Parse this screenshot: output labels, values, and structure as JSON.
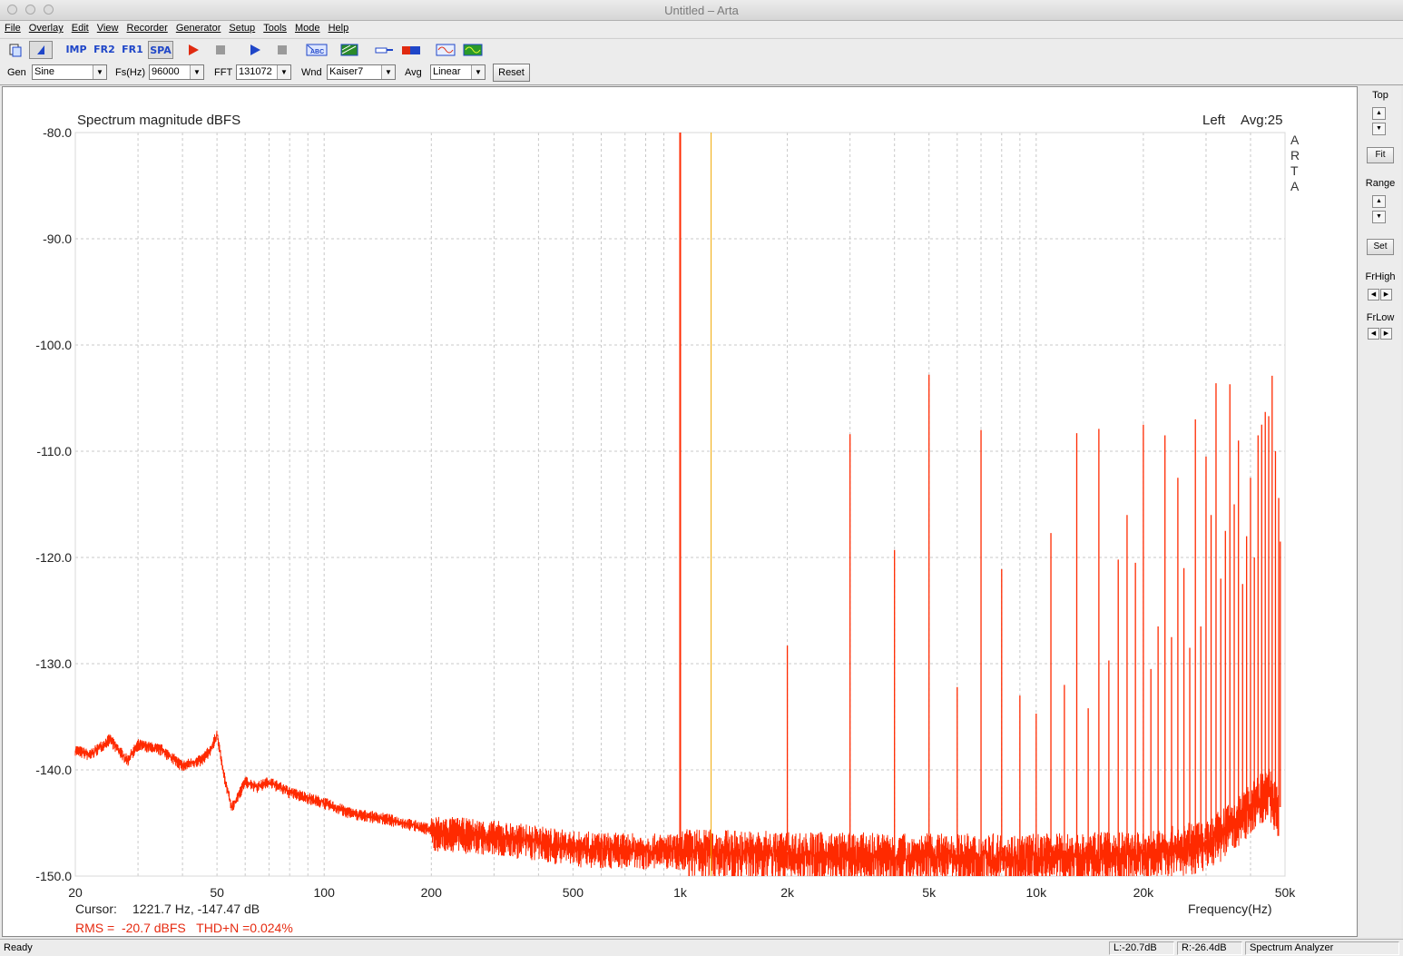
{
  "window": {
    "title": "Untitled – Arta"
  },
  "menu": [
    "File",
    "Overlay",
    "Edit",
    "View",
    "Recorder",
    "Generator",
    "Setup",
    "Tools",
    "Mode",
    "Help"
  ],
  "toolbar": {
    "imp_label": "IMP",
    "fr2_label": "FR2",
    "fr1_label": "FR1",
    "spa_label": "SPA",
    "icons": [
      "new-file-icon",
      "analyzer-cursor-icon",
      "imp-icon",
      "fr2-icon",
      "fr1-icon",
      "spa-icon",
      "record-icon",
      "stop-icon",
      "play-icon",
      "stop2-icon",
      "abc-icon",
      "spectrogram-icon",
      "probe-icon",
      "level-meter-icon",
      "generator-icon",
      "scope-icon"
    ]
  },
  "settings": {
    "gen_label": "Gen",
    "gen_value": "Sine",
    "fs_label": "Fs(Hz)",
    "fs_value": "96000",
    "fft_label": "FFT",
    "fft_value": "131072",
    "wnd_label": "Wnd",
    "wnd_value": "Kaiser7",
    "avg_label": "Avg",
    "avg_value": "Linear",
    "reset_label": "Reset"
  },
  "plot": {
    "channel": "Left",
    "avg": "Avg:25",
    "brand_letters": [
      "A",
      "R",
      "T",
      "A"
    ],
    "cursor_label": "Cursor:",
    "cursor_value": "1221.7 Hz, -147.47 dB",
    "rms_text": "RMS =  -20.7 dBFS   THD+N =0.024%"
  },
  "right_panel": {
    "top_label": "Top",
    "fit_label": "Fit",
    "range_label": "Range",
    "set_label": "Set",
    "frhigh_label": "FrHigh",
    "frlow_label": "FrLow"
  },
  "status": {
    "ready": "Ready",
    "left_level": "L:-20.7dB",
    "right_level": "R:-26.4dB",
    "mode": "Spectrum Analyzer"
  },
  "colors": {
    "trace": "#ff2a00",
    "cursor": "#f0a800",
    "grid": "#c8c8c8"
  },
  "chart_data": {
    "type": "line",
    "title": "Spectrum magnitude dBFS",
    "xlabel": "Frequency(Hz)",
    "ylabel": "",
    "xscale": "log",
    "xlim": [
      20,
      50000
    ],
    "ylim": [
      -150,
      -80
    ],
    "yticks": [
      -80,
      -90,
      -100,
      -110,
      -120,
      -130,
      -140,
      -150
    ],
    "ytick_labels": [
      "-80.0",
      "-90.0",
      "-100.0",
      "-110.0",
      "-120.0",
      "-130.0",
      "-140.0",
      "-150.0"
    ],
    "xticks": [
      20,
      50,
      100,
      200,
      500,
      1000,
      2000,
      5000,
      10000,
      20000,
      50000
    ],
    "xtick_labels": [
      "20",
      "50",
      "100",
      "200",
      "500",
      "1k",
      "2k",
      "5k",
      "10k",
      "20k",
      "50k"
    ],
    "grid": true,
    "cursor_hz": 1221.7,
    "noise_floor": {
      "x": [
        20,
        22,
        25,
        28,
        30,
        35,
        40,
        45,
        48,
        50,
        52,
        55,
        60,
        65,
        70,
        80,
        90,
        100,
        120,
        150,
        200,
        300,
        400,
        500,
        700,
        1000,
        2000,
        5000,
        10000,
        20000,
        30000,
        35000,
        40000,
        45000,
        48000
      ],
      "y": [
        -138,
        -138.5,
        -137,
        -139,
        -137.5,
        -138,
        -139.5,
        -139,
        -138,
        -136.5,
        -140,
        -143.5,
        -141,
        -141.5,
        -141,
        -142,
        -142.5,
        -143,
        -144,
        -144.5,
        -145.5,
        -146,
        -146.5,
        -147,
        -147.2,
        -147.3,
        -147.6,
        -147.8,
        -147.8,
        -147.6,
        -146.5,
        -145,
        -143,
        -141.5,
        -143.5
      ]
    },
    "harmonics": [
      {
        "x": 1000,
        "y": -80
      },
      {
        "x": 2000,
        "y": -128.3
      },
      {
        "x": 3000,
        "y": -108.4
      },
      {
        "x": 4000,
        "y": -119.3
      },
      {
        "x": 5000,
        "y": -102.8
      },
      {
        "x": 6000,
        "y": -132.2
      },
      {
        "x": 7000,
        "y": -108.0
      },
      {
        "x": 8000,
        "y": -121.1
      },
      {
        "x": 9000,
        "y": -133.0
      },
      {
        "x": 10000,
        "y": -134.7
      },
      {
        "x": 11000,
        "y": -117.7
      },
      {
        "x": 12000,
        "y": -132.0
      },
      {
        "x": 13000,
        "y": -108.3
      },
      {
        "x": 14000,
        "y": -134.2
      },
      {
        "x": 15000,
        "y": -107.9
      },
      {
        "x": 16000,
        "y": -129.7
      },
      {
        "x": 17000,
        "y": -120.2
      },
      {
        "x": 18000,
        "y": -116.0
      },
      {
        "x": 19000,
        "y": -120.5
      },
      {
        "x": 20000,
        "y": -107.5
      },
      {
        "x": 21000,
        "y": -130.5
      },
      {
        "x": 22000,
        "y": -126.5
      },
      {
        "x": 23000,
        "y": -108.5
      },
      {
        "x": 24000,
        "y": -127.5
      },
      {
        "x": 25000,
        "y": -112.5
      },
      {
        "x": 26000,
        "y": -121.0
      },
      {
        "x": 27000,
        "y": -128.5
      },
      {
        "x": 28000,
        "y": -107.0
      },
      {
        "x": 29000,
        "y": -126.5
      },
      {
        "x": 30000,
        "y": -110.5
      },
      {
        "x": 31000,
        "y": -116.0
      },
      {
        "x": 32000,
        "y": -103.6
      },
      {
        "x": 33000,
        "y": -122.0
      },
      {
        "x": 34000,
        "y": -117.5
      },
      {
        "x": 35000,
        "y": -103.7
      },
      {
        "x": 36000,
        "y": -115.0
      },
      {
        "x": 37000,
        "y": -109.0
      },
      {
        "x": 38000,
        "y": -122.5
      },
      {
        "x": 39000,
        "y": -118.0
      },
      {
        "x": 40000,
        "y": -112.5
      },
      {
        "x": 41000,
        "y": -120.0
      },
      {
        "x": 42000,
        "y": -108.5
      },
      {
        "x": 43000,
        "y": -107.5
      },
      {
        "x": 44000,
        "y": -106.3
      },
      {
        "x": 45000,
        "y": -106.7
      },
      {
        "x": 46000,
        "y": -102.9
      },
      {
        "x": 47000,
        "y": -110.0
      },
      {
        "x": 48000,
        "y": -114.4
      },
      {
        "x": 48500,
        "y": -118.5
      }
    ]
  }
}
